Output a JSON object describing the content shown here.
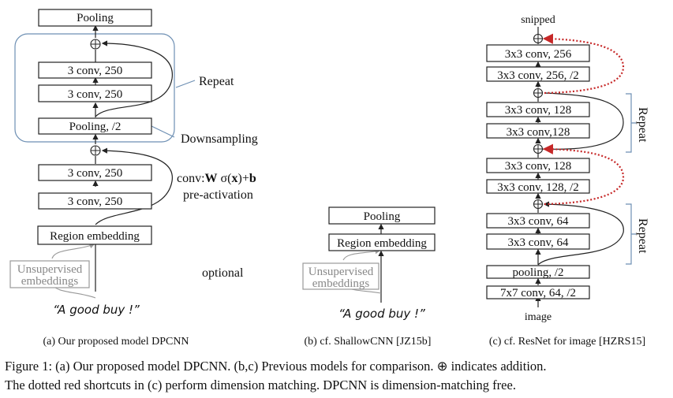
{
  "figure": {
    "panel_a": {
      "blocks": [
        "Pooling",
        "3 conv, 250",
        "3 conv, 250",
        "Pooling, /2",
        "3 conv, 250",
        "3 conv, 250",
        "Region embedding"
      ],
      "unsupervised": [
        "Unsupervised",
        "embeddings"
      ],
      "input": "“A good buy !”",
      "annotations": {
        "repeat": "Repeat",
        "downsampling": "Downsampling",
        "conv_formula_prefix": "conv:",
        "conv_formula_W": "W",
        "conv_formula_sigma": " σ(",
        "conv_formula_x": "x",
        "conv_formula_plus": ")+",
        "conv_formula_b": "b",
        "preactivation": "pre-activation",
        "optional": "optional"
      },
      "subcaption": "(a)  Our proposed model DPCNN"
    },
    "panel_b": {
      "blocks": [
        "Pooling",
        "Region embedding"
      ],
      "unsupervised": [
        "Unsupervised",
        "embeddings"
      ],
      "input": "“A good buy !”",
      "subcaption": "(b)  cf. ShallowCNN [JZ15b]"
    },
    "panel_c": {
      "top_label": "snipped",
      "blocks": [
        "3x3 conv, 256",
        "3x3 conv, 256, /2",
        "3x3 conv, 128",
        "3x3 conv,128",
        "3x3 conv, 128",
        "3x3 conv, 128, /2",
        "3x3 conv, 64",
        "3x3 conv, 64",
        "pooling, /2",
        "7x7 conv, 64, /2"
      ],
      "input": "image",
      "repeat": "Repeat",
      "subcaption": "(c)  cf. ResNet for image [HZRS15]"
    },
    "plus_symbol": "⊕",
    "caption": {
      "line1_a": "Figure 1:  (a) Our proposed model DPCNN. (b,c) Previous models for comparison.  ",
      "line1_b": " indicates addition.",
      "line2": "The dotted red shortcuts in (c) perform dimension matching. DPCNN is dimension-matching free."
    },
    "colors": {
      "shortcut_red": "#c62828",
      "repeat_blue": "#6d8fb3",
      "muted_gray": "#888888"
    }
  }
}
